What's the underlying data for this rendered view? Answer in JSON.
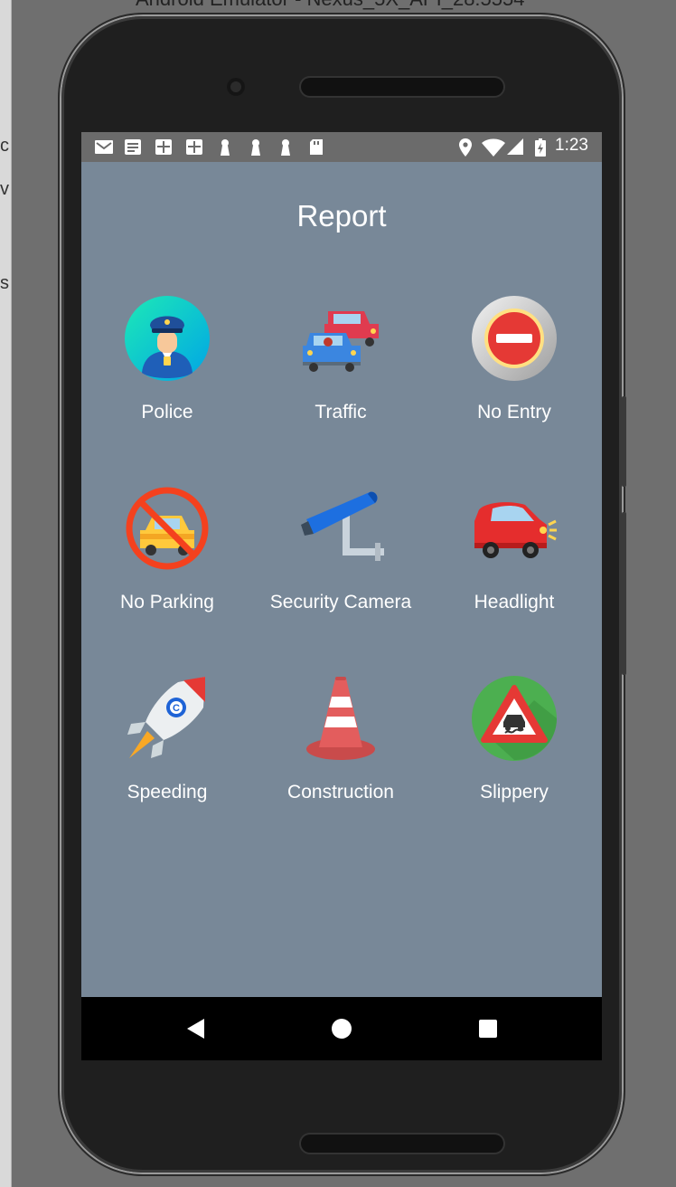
{
  "window": {
    "title": "Android Emulator - Nexus_5X_API_28:5554"
  },
  "statusbar": {
    "time": "1:23",
    "left_icons": [
      "gmail-icon",
      "news-icon",
      "calendar-icon",
      "calendar-icon",
      "keyhole-icon",
      "keyhole-icon",
      "keyhole-icon",
      "sd-card-icon"
    ],
    "right_icons": [
      "location-icon",
      "wifi-icon",
      "signal-icon",
      "battery-charging-icon"
    ]
  },
  "app": {
    "title": "Report",
    "background": "#788898"
  },
  "tiles": [
    {
      "id": "police",
      "label": "Police",
      "icon": "police-officer-icon"
    },
    {
      "id": "traffic",
      "label": "Traffic",
      "icon": "traffic-cars-icon"
    },
    {
      "id": "no-entry",
      "label": "No Entry",
      "icon": "no-entry-icon"
    },
    {
      "id": "no-parking",
      "label": "No Parking",
      "icon": "no-parking-icon"
    },
    {
      "id": "security-camera",
      "label": "Security Camera",
      "icon": "security-camera-icon"
    },
    {
      "id": "headlight",
      "label": "Headlight",
      "icon": "car-headlight-icon"
    },
    {
      "id": "speeding",
      "label": "Speeding",
      "icon": "rocket-icon"
    },
    {
      "id": "construction",
      "label": "Construction",
      "icon": "traffic-cone-icon"
    },
    {
      "id": "slippery",
      "label": "Slippery",
      "icon": "slippery-road-icon"
    }
  ],
  "navbar": {
    "buttons": [
      "back-icon",
      "home-icon",
      "recents-icon"
    ]
  }
}
